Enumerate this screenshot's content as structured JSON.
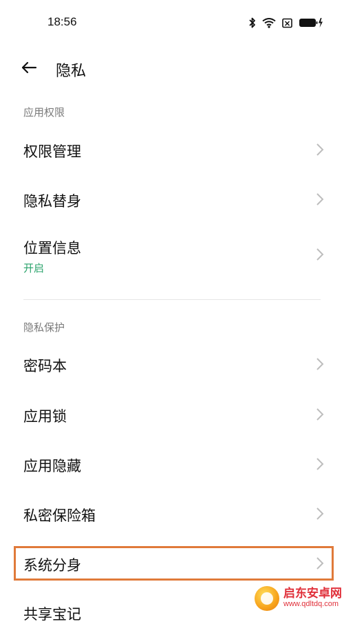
{
  "status_bar": {
    "time": "18:56",
    "icons": [
      "bluetooth-icon",
      "wifi-icon",
      "sim-icon",
      "battery-charging-icon"
    ]
  },
  "header": {
    "back_icon": "arrow-left-icon",
    "title": "隐私"
  },
  "sections": [
    {
      "label": "应用权限",
      "items": [
        {
          "label": "权限管理"
        },
        {
          "label": "隐私替身"
        },
        {
          "label": "位置信息",
          "subtitle": "开启"
        }
      ]
    },
    {
      "label": "隐私保护",
      "items": [
        {
          "label": "密码本"
        },
        {
          "label": "应用锁"
        },
        {
          "label": "应用隐藏"
        },
        {
          "label": "私密保险箱"
        },
        {
          "label": "系统分身"
        },
        {
          "label": "共享宝记"
        }
      ]
    }
  ],
  "highlight_color": "#e07a3a",
  "subtitle_color": "#2aa36b",
  "watermark": {
    "title": "启东安卓网",
    "url": "www.qdltdq.com"
  }
}
